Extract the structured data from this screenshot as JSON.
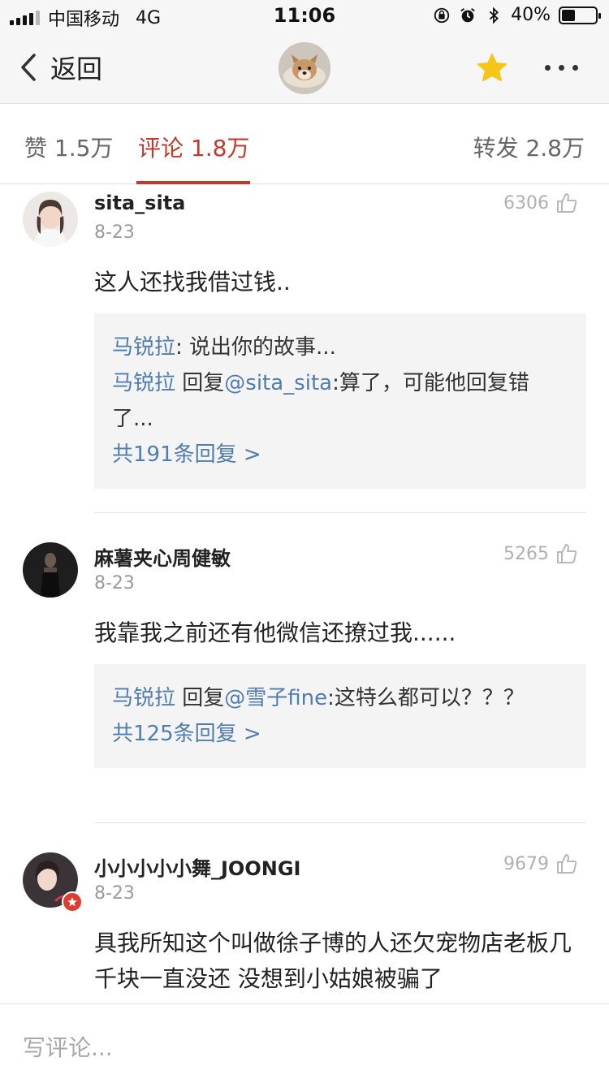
{
  "status_bar": {
    "carrier": "中国移动",
    "network": "4G",
    "time": "11:06",
    "battery_percent": "40%",
    "battery_level": 0.4
  },
  "nav": {
    "back_label": "返回",
    "avatar_icon": "dog-avatar",
    "favorite_icon": "star-icon",
    "favorite_color": "#f5c518",
    "more_icon": "more-dots-icon"
  },
  "tabs": [
    {
      "label": "赞 1.5万",
      "active": false
    },
    {
      "label": "评论 1.8万",
      "active": true
    },
    {
      "label": "转发 2.8万",
      "active": false
    }
  ],
  "accent_color": "#c0392b",
  "link_color": "#507daf",
  "comments": [
    {
      "user": "sita_sita",
      "date": "8-23",
      "likes": "6306",
      "text": "这人还找我借过钱..",
      "replies": [
        {
          "user": "马锐拉",
          "text": ": 说出你的故事..."
        },
        {
          "user": "马锐拉",
          "mid": " 回复",
          "mention": "@sita_sita",
          "text": ":算了，可能他回复错了..."
        }
      ],
      "reply_count": "共191条回复 >"
    },
    {
      "user": "麻薯夹心周健敏",
      "date": "8-23",
      "likes": "5265",
      "text": "我靠我之前还有他微信还撩过我......",
      "replies": [
        {
          "user": "马锐拉",
          "mid": " 回复",
          "mention": "@雪子fine",
          "text": ":这特么都可以？？？"
        }
      ],
      "reply_count": "共125条回复 >"
    },
    {
      "user": "小小小小小舞_JOONGI",
      "date": "8-23",
      "likes": "9679",
      "text": "具我所知这个叫做徐子博的人还欠宠物店老板几千块一直没还 没想到小姑娘被骗了"
    }
  ],
  "input": {
    "placeholder": "写评论..."
  }
}
